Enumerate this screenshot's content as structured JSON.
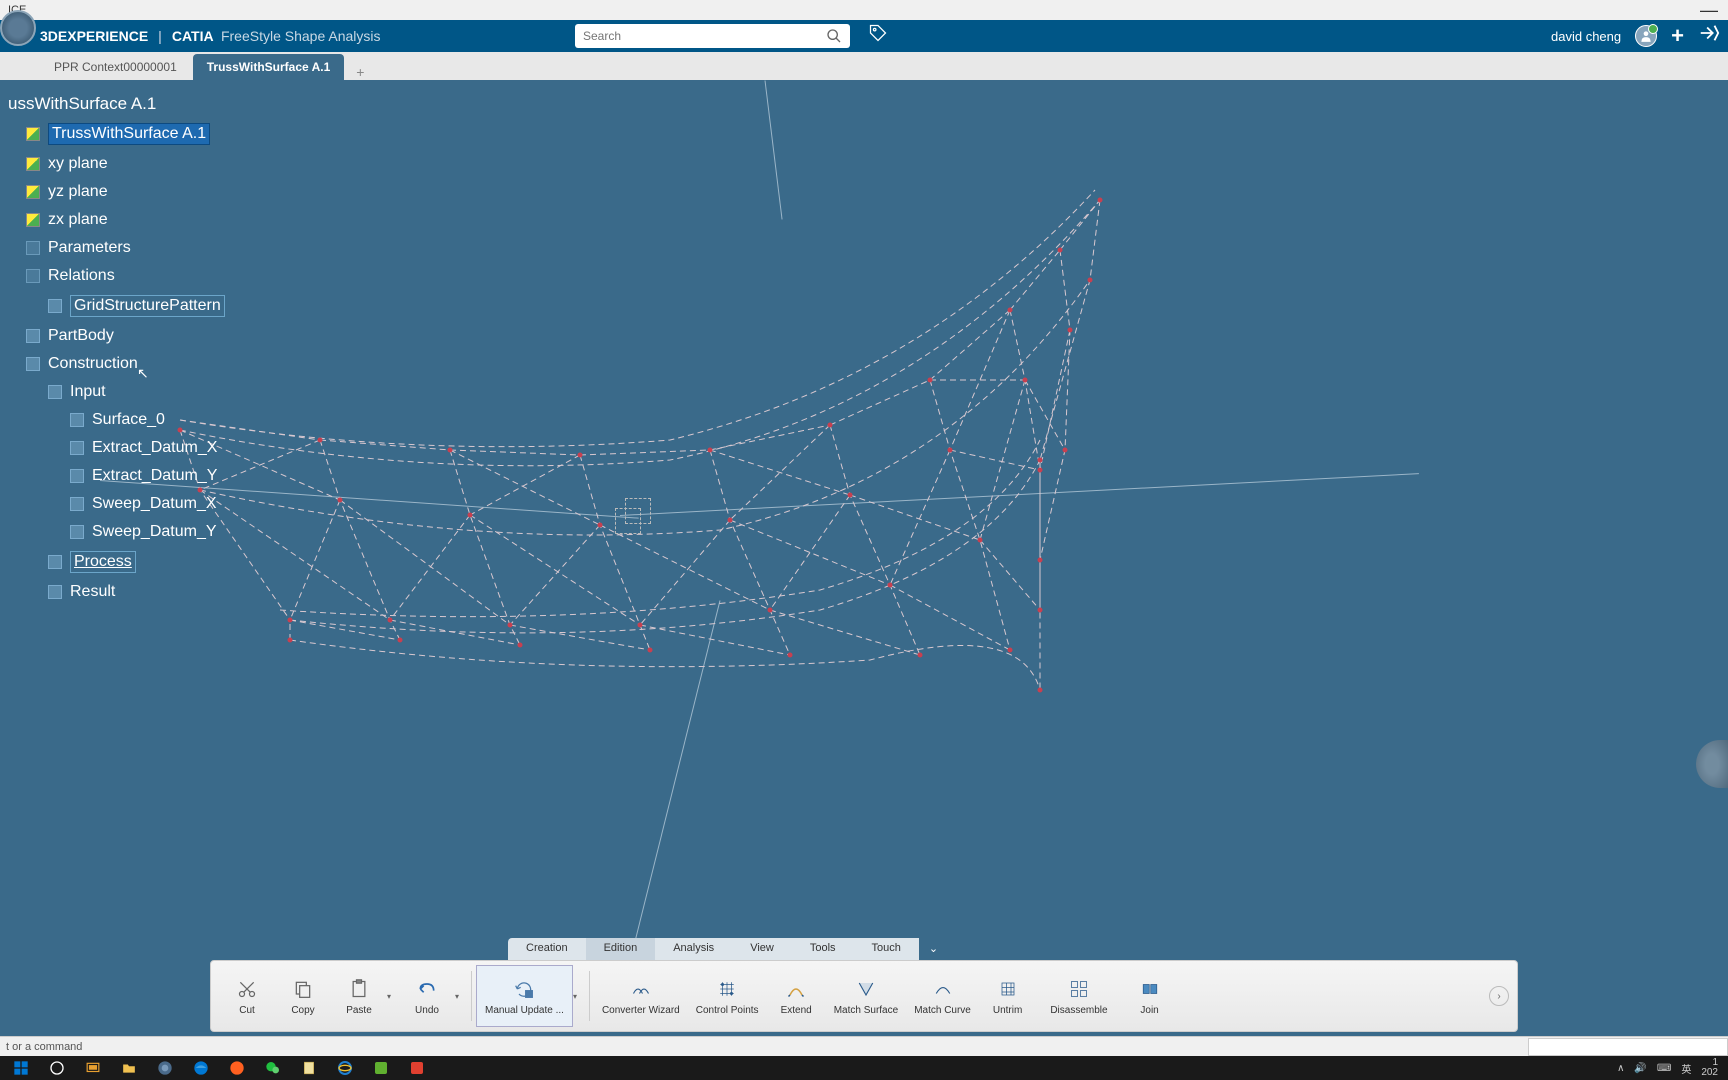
{
  "titlebar": {
    "text": "ICE"
  },
  "header": {
    "brand_prefix": "3D",
    "brand_main": "EXPERIENCE",
    "brand_catia": "CATIA",
    "brand_sub": "FreeStyle Shape Analysis",
    "search_placeholder": "Search",
    "user_name": "david cheng"
  },
  "tabs": [
    {
      "label": "PPR Context00000001",
      "active": false
    },
    {
      "label": "TrussWithSurface A.1",
      "active": true
    }
  ],
  "tree": {
    "root": "ussWithSurface A.1",
    "items": [
      {
        "label": "TrussWithSurface A.1",
        "cls": "selected",
        "indent": 0
      },
      {
        "label": "xy plane",
        "cls": "",
        "indent": 0
      },
      {
        "label": "yz plane",
        "cls": "",
        "indent": 0
      },
      {
        "label": "zx plane",
        "cls": "",
        "indent": 0
      },
      {
        "label": "Parameters",
        "cls": "",
        "indent": 0
      },
      {
        "label": "Relations",
        "cls": "",
        "indent": 0
      },
      {
        "label": "GridStructurePattern",
        "cls": "highlighted",
        "indent": 1
      },
      {
        "label": "PartBody",
        "cls": "",
        "indent": 0
      },
      {
        "label": "Construction",
        "cls": "",
        "indent": 0
      },
      {
        "label": "Input",
        "cls": "",
        "indent": 1
      },
      {
        "label": "Surface_0",
        "cls": "",
        "indent": 2
      },
      {
        "label": "Extract_Datum_X",
        "cls": "",
        "indent": 2
      },
      {
        "label": "Extract_Datum_Y",
        "cls": "",
        "indent": 2
      },
      {
        "label": "Sweep_Datum_X",
        "cls": "",
        "indent": 2
      },
      {
        "label": "Sweep_Datum_Y",
        "cls": "",
        "indent": 2
      },
      {
        "label": "Process",
        "cls": "underlined",
        "indent": 1
      },
      {
        "label": "Result",
        "cls": "",
        "indent": 1
      }
    ]
  },
  "action_tabs": [
    {
      "label": "Creation",
      "active": false
    },
    {
      "label": "Edition",
      "active": true
    },
    {
      "label": "Analysis",
      "active": false
    },
    {
      "label": "View",
      "active": false
    },
    {
      "label": "Tools",
      "active": false
    },
    {
      "label": "Touch",
      "active": false
    }
  ],
  "toolbar": {
    "cut": "Cut",
    "copy": "Copy",
    "paste": "Paste",
    "undo": "Undo",
    "manual_update": "Manual Update ...",
    "converter": "Converter Wizard",
    "control_points": "Control Points",
    "extend": "Extend",
    "match_surface": "Match Surface",
    "match_curve": "Match Curve",
    "untrim": "Untrim",
    "disassemble": "Disassemble",
    "join": "Join"
  },
  "statusbar": {
    "text": "t or a command"
  },
  "taskbar": {
    "tray": [
      "∧",
      "🔊",
      "⌨",
      "英"
    ],
    "time": "1\n202"
  }
}
